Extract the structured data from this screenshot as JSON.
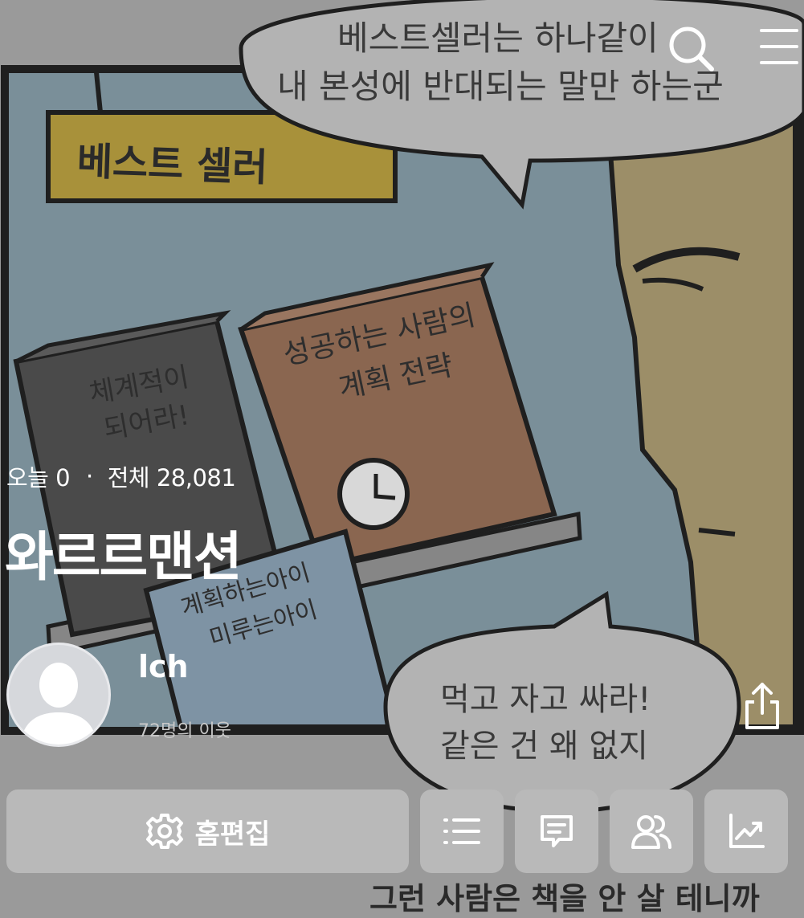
{
  "comic": {
    "top_bubble_line1": "베스트셀러는 하나같이",
    "top_bubble_line2": "내 본성에 반대되는 말만 하는군",
    "sign_text": "베스트 셀러",
    "book1_title_line1": "체계적이",
    "book1_title_line2": "되어라!",
    "book2_title_line1": "성공하는 사람의",
    "book2_title_line2": "계획 전략",
    "book3_title_line1": "계획하는아이",
    "book3_title_line2": "미루는아이",
    "bottom_bubble_line1": "먹고 자고 싸라!",
    "bottom_bubble_line2": "같은 건 왜 없지",
    "caption": "그런 사람은 책을 안 살 테니까"
  },
  "profile": {
    "today_label": "오늘 0",
    "total_label": "전체 28,081",
    "blog_title": "와르르맨션",
    "owner_name": "lch",
    "neighbors": "72명의 이웃"
  },
  "toolbar": {
    "edit_home_label": "홈편집"
  },
  "icons": {
    "search": "search-icon",
    "menu": "menu-icon",
    "share": "share-icon",
    "settings": "gear-icon",
    "list": "list-icon",
    "guestbook": "message-icon",
    "neighbors": "people-icon",
    "stats": "chart-icon"
  },
  "colors": {
    "overlay": "#9a9a9a",
    "sky": "#7a8f99",
    "sign": "#a8913a",
    "face": "#9c8e68",
    "toolbar_button": "#b9b9b9"
  }
}
